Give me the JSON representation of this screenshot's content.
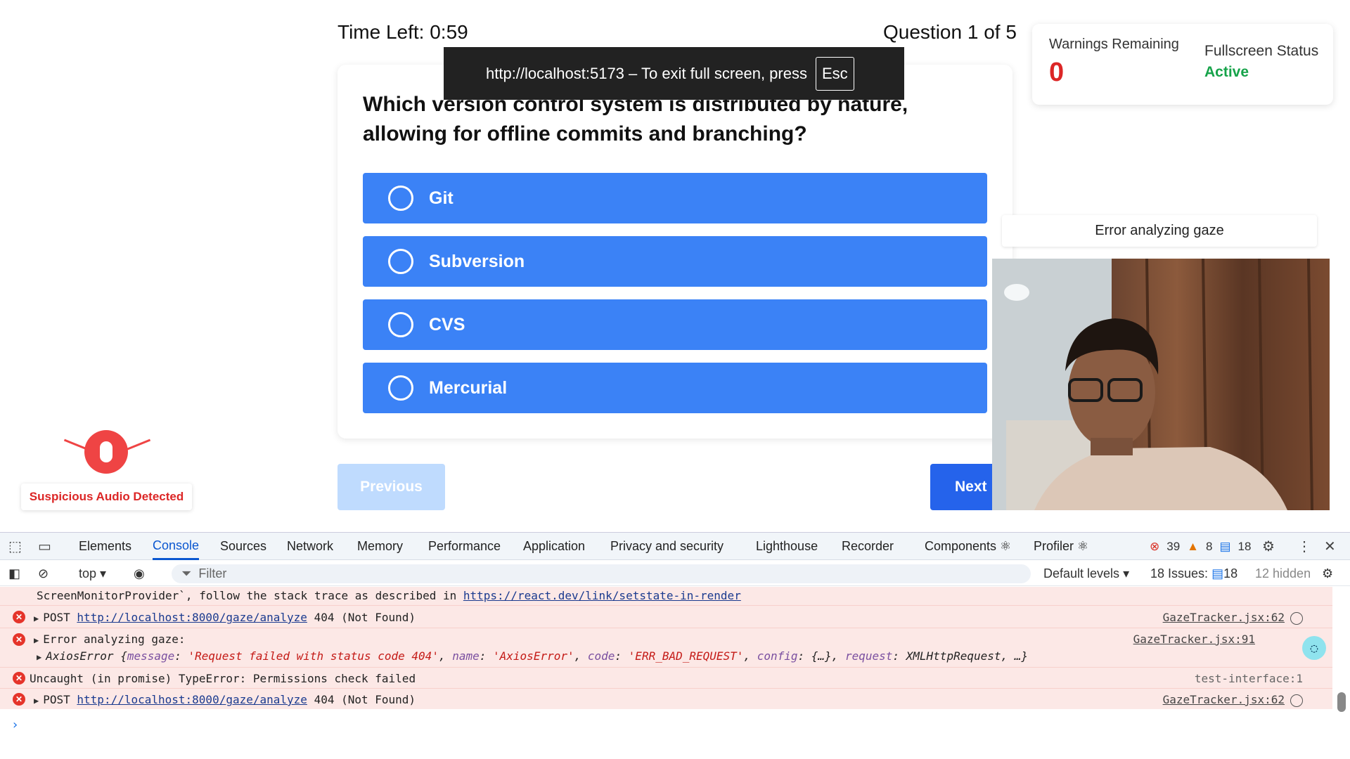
{
  "quiz": {
    "timer": "Time Left: 0:59",
    "question_count": "Question 1 of 5",
    "question": "Which version control system is distributed by nature, allowing for offline commits and branching?",
    "options": [
      "Git",
      "Subversion",
      "CVS",
      "Mercurial"
    ],
    "previous_label": "Previous",
    "next_label": "Next"
  },
  "fullscreen_toast": {
    "message": "http://localhost:5173 – To exit full screen, press",
    "key": "Esc"
  },
  "status": {
    "warnings_label": "Warnings Remaining",
    "warnings_value": "0",
    "fullscreen_label": "Fullscreen Status",
    "fullscreen_value": "Active"
  },
  "gaze": {
    "status": "Error analyzing gaze"
  },
  "audio": {
    "alert": "Suspicious Audio Detected"
  },
  "devtools": {
    "tabs": [
      "Elements",
      "Console",
      "Sources",
      "Network",
      "Memory",
      "Performance",
      "Application",
      "Privacy and security",
      "Lighthouse",
      "Recorder",
      "Components ⚛",
      "Profiler ⚛"
    ],
    "active_tab": "Console",
    "counts": {
      "errors": "39",
      "warnings": "8",
      "messages": "18"
    },
    "toolbar": {
      "context": "top",
      "filter_placeholder": "Filter",
      "levels": "Default levels",
      "issues_label": "18 Issues:",
      "issues_count": "18",
      "hidden": "12 hidden"
    },
    "log": {
      "truncated": "ScreenMonitorProvider`, follow the stack trace as described in ",
      "truncated_link": "https://react.dev/link/setstate-in-render",
      "r1_method": "POST",
      "r1_url": "http://localhost:8000/gaze/analyze",
      "r1_status": "404 (Not Found)",
      "r1_src": "GazeTracker.jsx:62",
      "r2_text": "Error analyzing gaze:",
      "r2_src": "GazeTracker.jsx:91",
      "r2_obj_name": "AxiosError",
      "r2_obj_message": "'Request failed with status code 404'",
      "r2_obj_name_val": "'AxiosError'",
      "r2_obj_code": "'ERR_BAD_REQUEST'",
      "r2_obj_config": "{…}",
      "r2_obj_request": "XMLHttpRequest, …}",
      "r3_text": "Uncaught (in promise) TypeError: Permissions check failed",
      "r3_src": "test-interface:1",
      "r4_method": "POST",
      "r4_url": "http://localhost:8000/gaze/analyze",
      "r4_status": "404 (Not Found)",
      "r4_src": "GazeTracker.jsx:62"
    }
  },
  "colors": {
    "option_blue": "#3b82f6",
    "next_blue": "#2563eb",
    "warning_red": "#dc2626",
    "active_green": "#16a34a",
    "console_error_bg": "#fce8e6"
  },
  "icons": [
    "inspect-icon",
    "device-toggle-icon",
    "settings-icon",
    "more-icon",
    "close-icon",
    "sidebar-icon",
    "clear-icon",
    "eye-icon",
    "filter-icon",
    "gear-icon",
    "mic-icon",
    "ai-assist-icon"
  ]
}
